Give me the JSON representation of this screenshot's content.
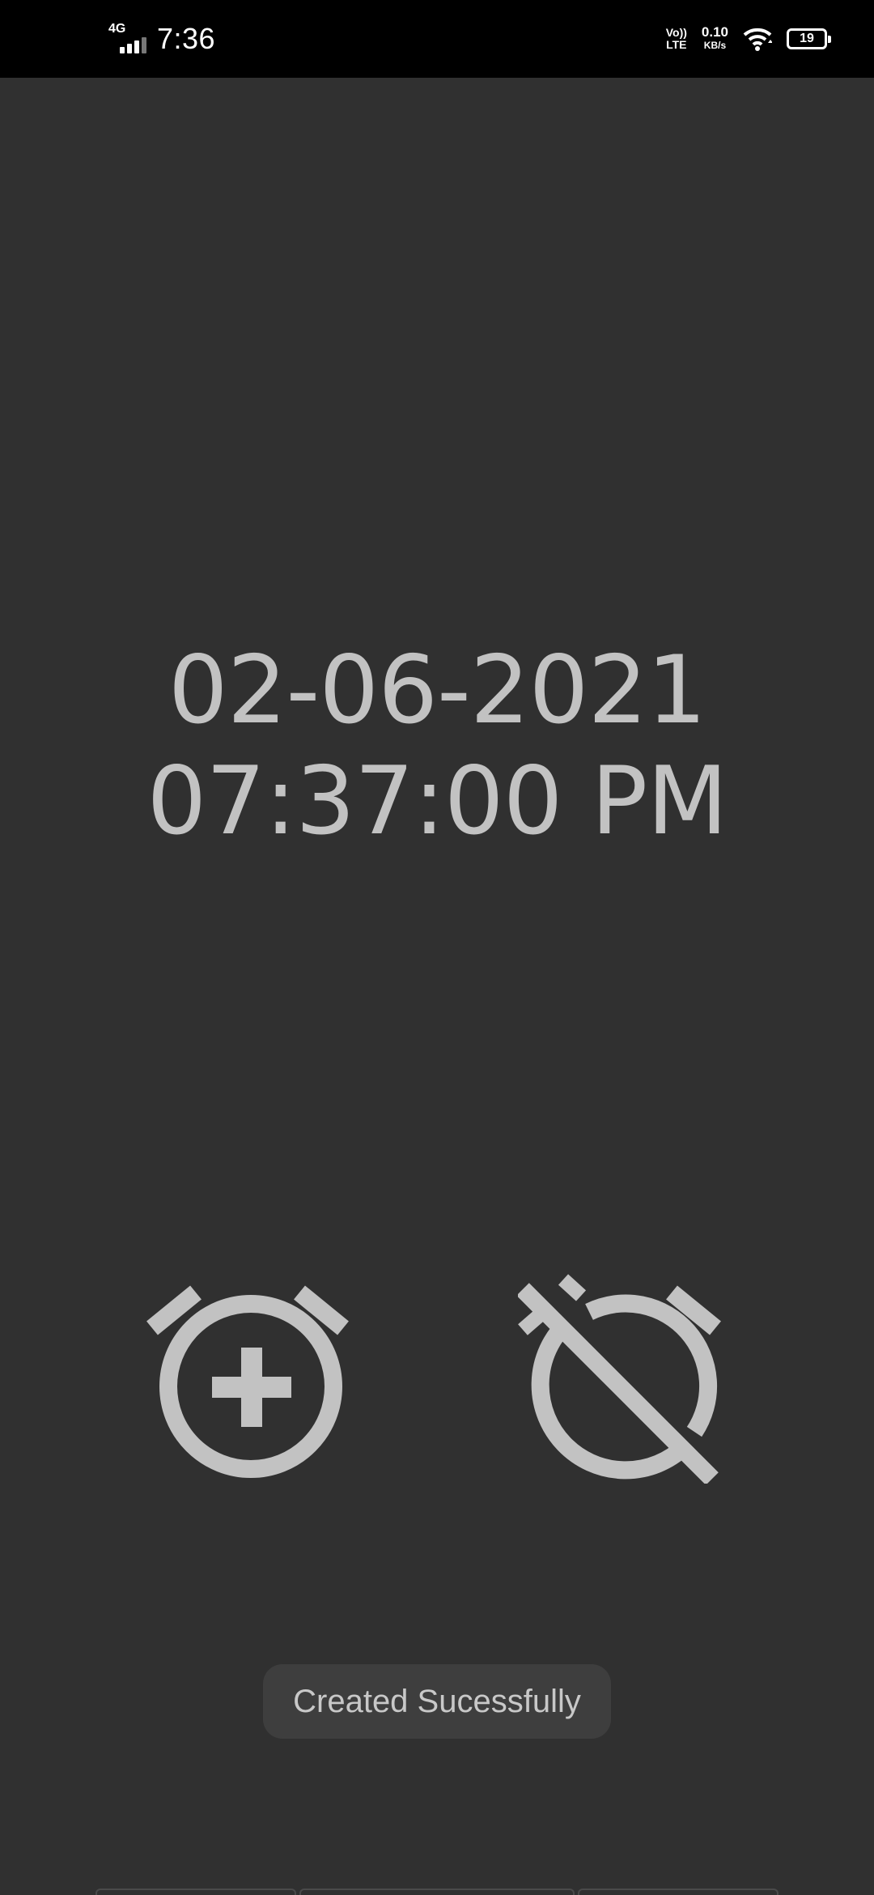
{
  "status_bar": {
    "network_type": "4G",
    "time": "7:36",
    "volte_top": "Vo))",
    "volte_bottom": "LTE",
    "speed_value": "0.10",
    "speed_unit": "KB/s",
    "battery_level": "19"
  },
  "display": {
    "date": "02-06-2021",
    "time": "07:37:00 PM"
  },
  "buttons": {
    "add_alarm_icon": "alarm-add-icon",
    "cancel_alarm_icon": "alarm-off-icon"
  },
  "toast": {
    "message": "Created Sucessfully"
  },
  "colors": {
    "background": "#303030",
    "status_bar": "#000000",
    "text": "#c2c2c2",
    "icon": "#c2c2c2",
    "toast_bg": "#3e3e3e"
  }
}
